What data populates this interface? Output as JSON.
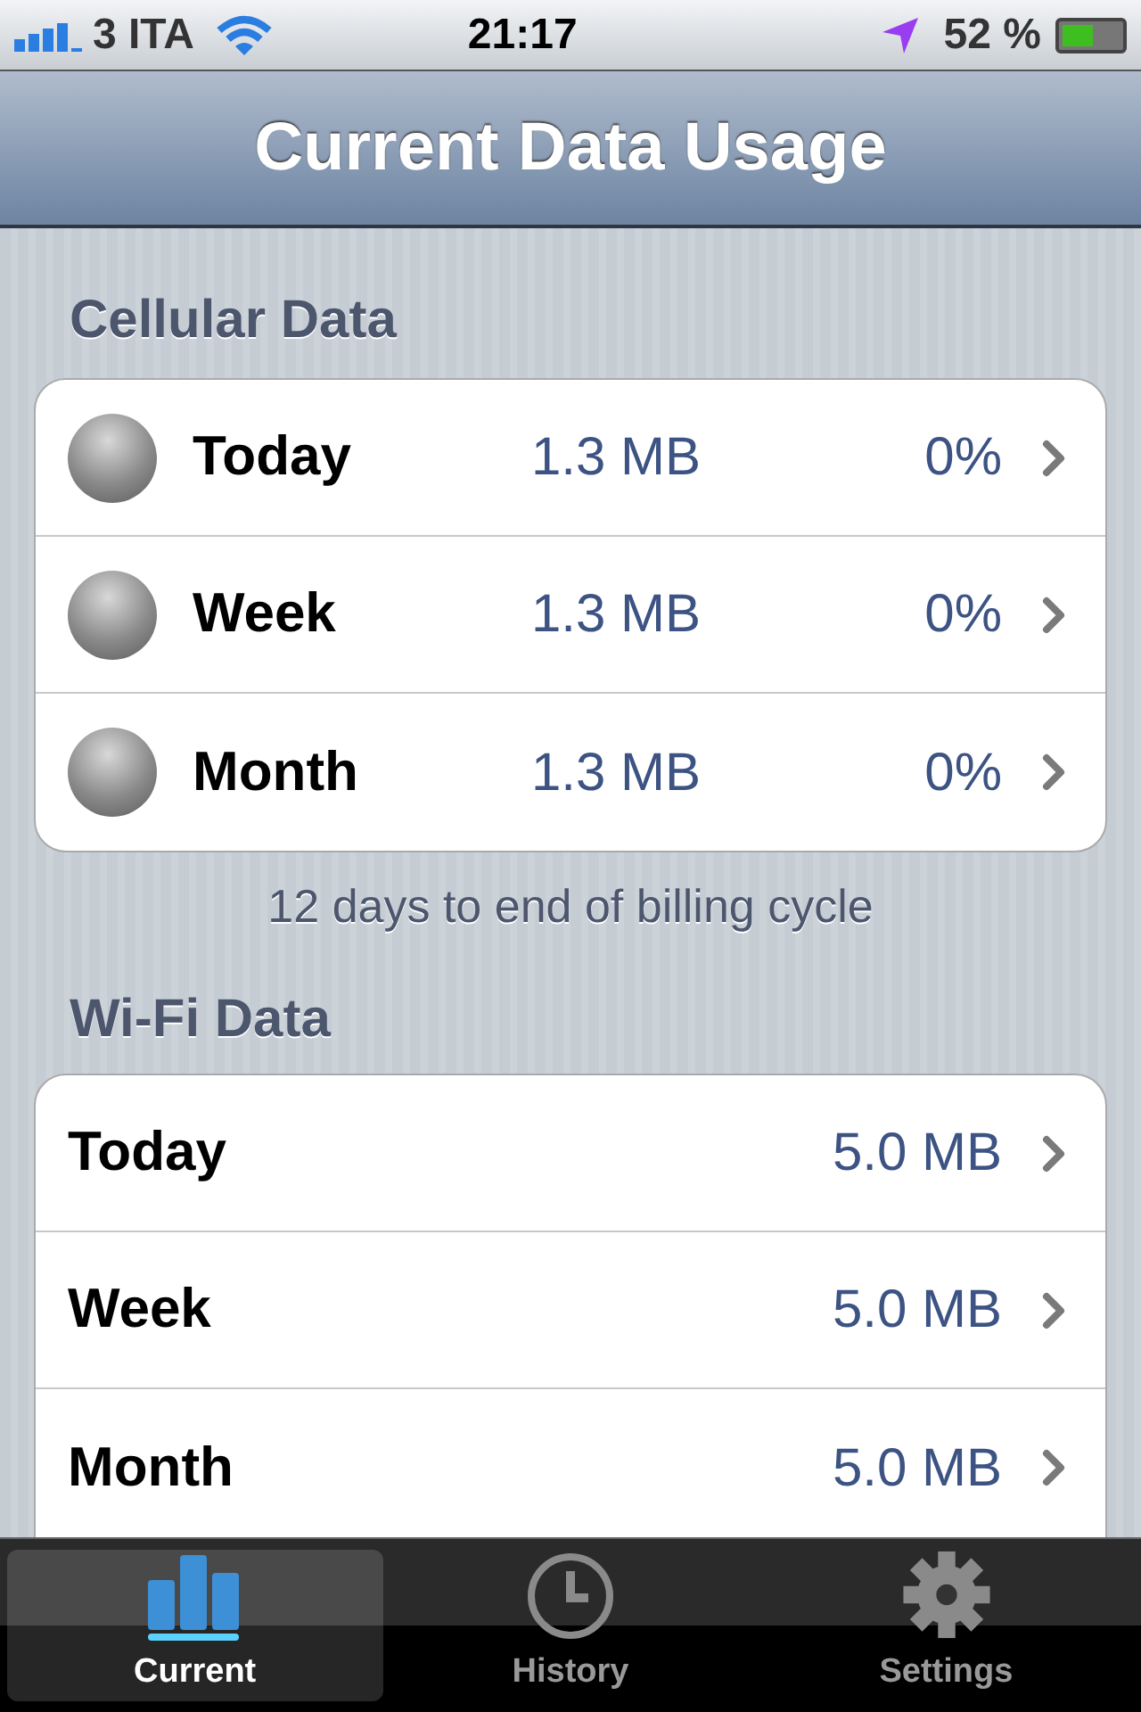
{
  "status_bar": {
    "carrier": "3 ITA",
    "time": "21:17",
    "battery": "52 %"
  },
  "nav_bar": {
    "title": "Current Data Usage"
  },
  "cellular": {
    "header": "Cellular Data",
    "rows": [
      {
        "label": "Today",
        "amount": "1.3 MB",
        "percent": "0%"
      },
      {
        "label": "Week",
        "amount": "1.3 MB",
        "percent": "0%"
      },
      {
        "label": "Month",
        "amount": "1.3 MB",
        "percent": "0%"
      }
    ],
    "footer": "12 days to end of billing cycle"
  },
  "wifi": {
    "header": "Wi-Fi Data",
    "rows": [
      {
        "label": "Today",
        "amount": "5.0 MB"
      },
      {
        "label": "Week",
        "amount": "5.0 MB"
      },
      {
        "label": "Month",
        "amount": "5.0 MB"
      }
    ]
  },
  "tab_bar": [
    {
      "label": "Current",
      "kind": "chart",
      "selected": true
    },
    {
      "label": "History",
      "kind": "clock",
      "selected": false
    },
    {
      "label": "Settings",
      "kind": "gear",
      "selected": false
    }
  ]
}
